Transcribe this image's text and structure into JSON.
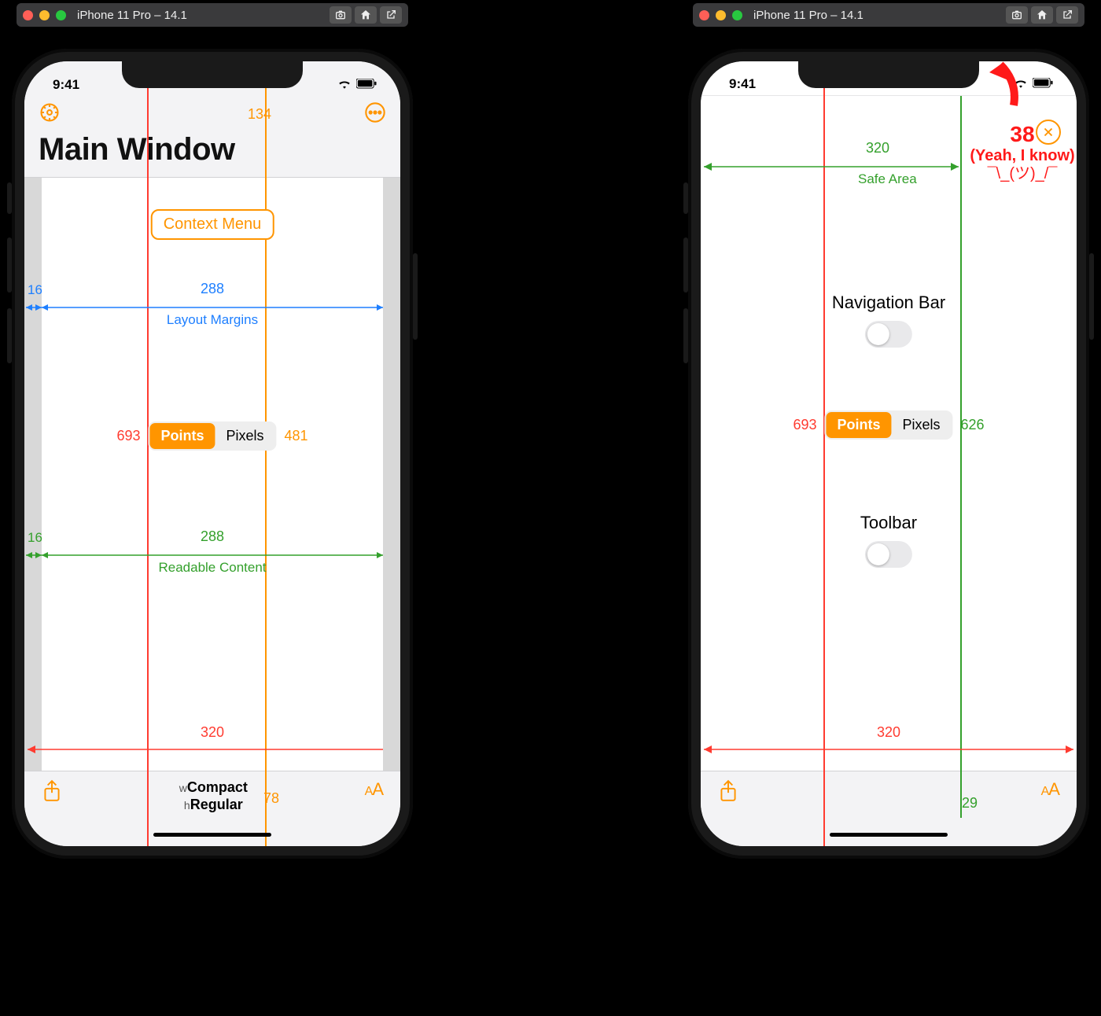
{
  "simulator": {
    "title": "iPhone 11 Pro – 14.1",
    "buttons": [
      "screenshot",
      "home",
      "share"
    ]
  },
  "status": {
    "time": "9:41"
  },
  "left": {
    "nav": {
      "topValue": "134",
      "title": "Main Window"
    },
    "contextMenu": "Context Menu",
    "layoutMargins": {
      "side": "16",
      "width": "288",
      "label": "Layout Margins"
    },
    "readable": {
      "side": "16",
      "width": "288",
      "label": "Readable Content"
    },
    "redHeight": "693",
    "orangeHeight": "481",
    "fullWidth": "320",
    "segment": {
      "a": "Points",
      "b": "Pixels"
    },
    "bottomValue": "78",
    "sizeClass": {
      "wPrefix": "w",
      "w": "Compact",
      "hPrefix": "h",
      "h": "Regular"
    }
  },
  "right": {
    "safeArea": {
      "width": "320",
      "label": "Safe Area"
    },
    "navToggle": "Navigation Bar",
    "toolbarToggle": "Toolbar",
    "redHeight": "693",
    "greenHeight": "626",
    "fullWidth": "320",
    "bottomGreen": "29",
    "segment": {
      "a": "Points",
      "b": "Pixels"
    },
    "annotation": {
      "value": "38",
      "note": "(Yeah, I know)",
      "shrug": "¯\\_(ツ)_/¯"
    }
  }
}
